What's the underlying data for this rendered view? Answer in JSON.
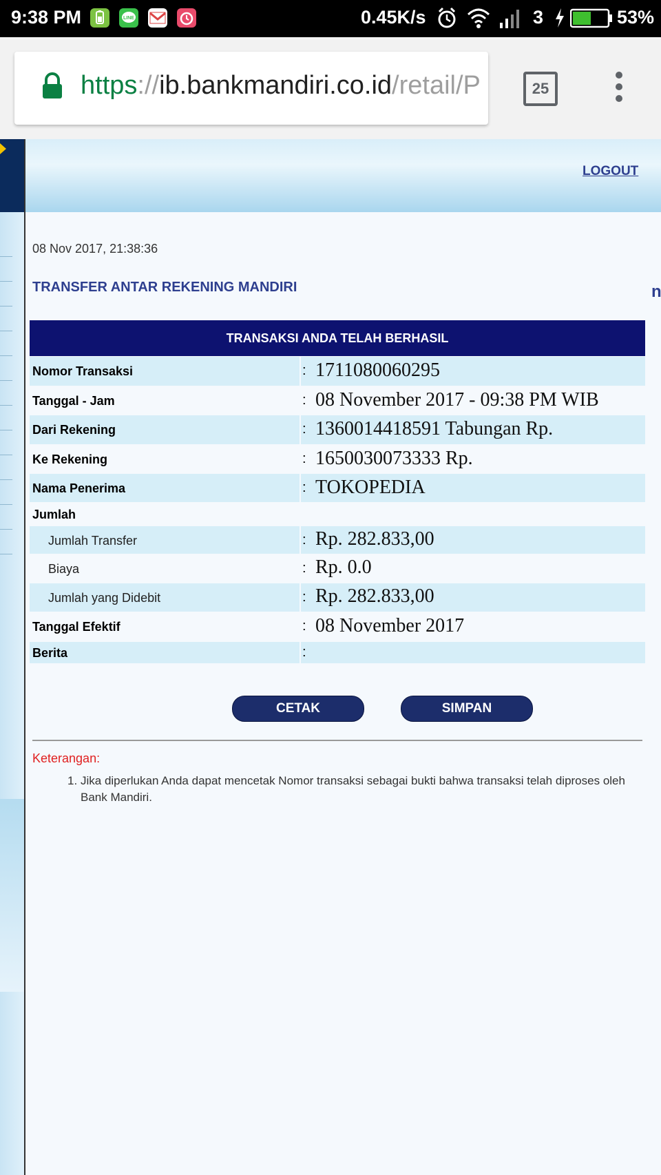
{
  "status_bar": {
    "time": "9:38 PM",
    "speed": "0.45K/s",
    "network": "3",
    "battery": "53%",
    "battery_level": 0.53,
    "icons": [
      "battery-app-icon",
      "line-icon",
      "gmail-icon",
      "alarm-app-icon",
      "alarm-icon",
      "wifi-icon",
      "signal-icon",
      "charging-icon",
      "battery-icon"
    ]
  },
  "browser": {
    "url_scheme": "https",
    "url_sep": "://",
    "url_host": "ib.bankmandiri.co.id",
    "url_path": "/retail/P",
    "tab_count": "25"
  },
  "header": {
    "logout": "LOGOUT"
  },
  "page": {
    "datetime": "08 Nov 2017, 21:38:36",
    "title": "TRANSFER ANTAR REKENING MANDIRI",
    "side_cut": "n"
  },
  "table": {
    "heading": "TRANSAKSI ANDA TELAH BERHASIL",
    "rows": [
      {
        "label": "Nomor Transaksi",
        "colon": ":",
        "value": "1711080060295"
      },
      {
        "label": "Tanggal - Jam",
        "colon": ":",
        "value": "08 November 2017 - 09:38 PM WIB"
      },
      {
        "label": "Dari Rekening",
        "colon": ":",
        "value": "1360014418591 Tabungan  Rp."
      },
      {
        "label": "Ke Rekening",
        "colon": ":",
        "value": "1650030073333  Rp."
      },
      {
        "label": "Nama Penerima",
        "colon": ":",
        "value": "TOKOPEDIA"
      },
      {
        "label": "Jumlah",
        "colon": "",
        "value": ""
      },
      {
        "label": "Jumlah Transfer",
        "colon": ":",
        "value": "Rp. 282.833,00"
      },
      {
        "label": "Biaya",
        "colon": ":",
        "value": "Rp. 0.0"
      },
      {
        "label": "Jumlah yang Didebit",
        "colon": ":",
        "value": "Rp. 282.833,00"
      },
      {
        "label": "Tanggal Efektif",
        "colon": ":",
        "value": "08 November 2017"
      },
      {
        "label": "Berita",
        "colon": ":",
        "value": ""
      }
    ]
  },
  "buttons": {
    "print": "CETAK",
    "save": "SIMPAN"
  },
  "notes": {
    "title": "Keterangan:",
    "items": [
      {
        "num": "1.",
        "text": "Jika diperlukan Anda dapat mencetak Nomor transaksi sebagai bukti bahwa transaksi telah diproses oleh Bank Mandiri."
      }
    ]
  }
}
